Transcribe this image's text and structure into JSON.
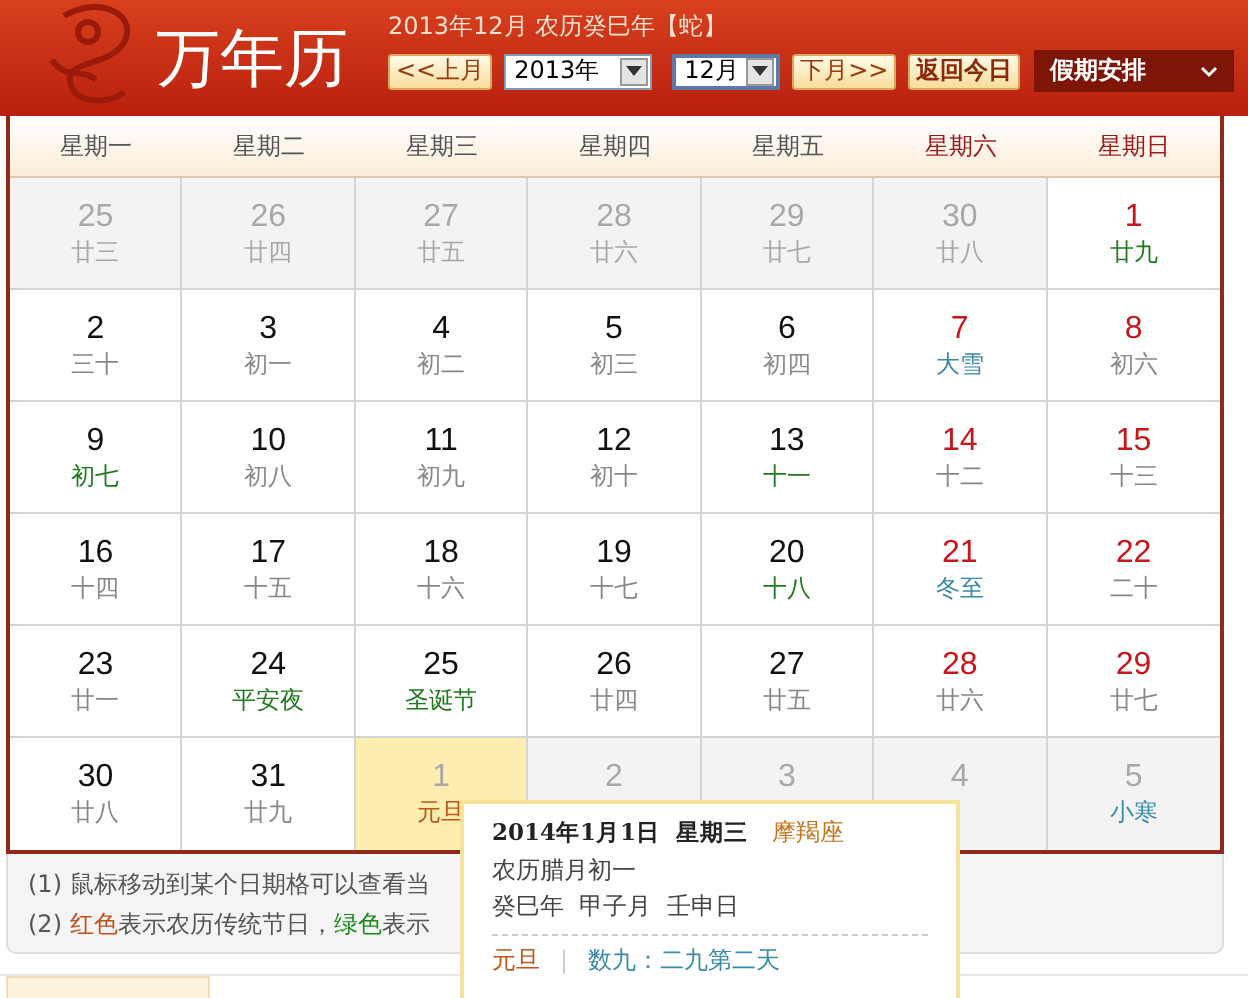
{
  "header": {
    "title": "万年历",
    "subtitle": "2013年12月 农历癸巳年【蛇】",
    "prev_button": "<<上月",
    "year_select": "2013年",
    "month_select": "12月",
    "next_button": "下月>>",
    "today_button": "返回今日",
    "holiday_menu": "假期安排"
  },
  "weekdays": [
    {
      "label": "星期一",
      "weekend": false
    },
    {
      "label": "星期二",
      "weekend": false
    },
    {
      "label": "星期三",
      "weekend": false
    },
    {
      "label": "星期四",
      "weekend": false
    },
    {
      "label": "星期五",
      "weekend": false
    },
    {
      "label": "星期六",
      "weekend": true
    },
    {
      "label": "星期日",
      "weekend": true
    }
  ],
  "weeks": [
    [
      {
        "day": "25",
        "sub": "廿三",
        "in_month": false,
        "color": "#a8a8a8",
        "selected": false
      },
      {
        "day": "26",
        "sub": "廿四",
        "in_month": false,
        "color": "#a8a8a8",
        "selected": false
      },
      {
        "day": "27",
        "sub": "廿五",
        "in_month": false,
        "color": "#a8a8a8",
        "selected": false
      },
      {
        "day": "28",
        "sub": "廿六",
        "in_month": false,
        "color": "#a8a8a8",
        "selected": false
      },
      {
        "day": "29",
        "sub": "廿七",
        "in_month": false,
        "color": "#a8a8a8",
        "selected": false
      },
      {
        "day": "30",
        "sub": "廿八",
        "in_month": false,
        "color": "#a8a8a8",
        "selected": false
      },
      {
        "day": "1",
        "sub": "廿九",
        "in_month": true,
        "weekend": true,
        "color": "#1d7a1d",
        "selected": false
      }
    ],
    [
      {
        "day": "2",
        "sub": "三十",
        "in_month": true,
        "weekend": false,
        "color": "#888888",
        "selected": false
      },
      {
        "day": "3",
        "sub": "初一",
        "in_month": true,
        "weekend": false,
        "color": "#888888",
        "selected": false
      },
      {
        "day": "4",
        "sub": "初二",
        "in_month": true,
        "weekend": false,
        "color": "#888888",
        "selected": false
      },
      {
        "day": "5",
        "sub": "初三",
        "in_month": true,
        "weekend": false,
        "color": "#888888",
        "selected": false
      },
      {
        "day": "6",
        "sub": "初四",
        "in_month": true,
        "weekend": false,
        "color": "#888888",
        "selected": false
      },
      {
        "day": "7",
        "sub": "大雪",
        "in_month": true,
        "weekend": true,
        "color": "#3a8aaa",
        "selected": false
      },
      {
        "day": "8",
        "sub": "初六",
        "in_month": true,
        "weekend": true,
        "color": "#888888",
        "selected": false
      }
    ],
    [
      {
        "day": "9",
        "sub": "初七",
        "in_month": true,
        "weekend": false,
        "color": "#1d7a1d",
        "selected": false
      },
      {
        "day": "10",
        "sub": "初八",
        "in_month": true,
        "weekend": false,
        "color": "#888888",
        "selected": false
      },
      {
        "day": "11",
        "sub": "初九",
        "in_month": true,
        "weekend": false,
        "color": "#888888",
        "selected": false
      },
      {
        "day": "12",
        "sub": "初十",
        "in_month": true,
        "weekend": false,
        "color": "#888888",
        "selected": false
      },
      {
        "day": "13",
        "sub": "十一",
        "in_month": true,
        "weekend": false,
        "color": "#1d7a1d",
        "selected": false
      },
      {
        "day": "14",
        "sub": "十二",
        "in_month": true,
        "weekend": true,
        "color": "#888888",
        "selected": false
      },
      {
        "day": "15",
        "sub": "十三",
        "in_month": true,
        "weekend": true,
        "color": "#888888",
        "selected": false
      }
    ],
    [
      {
        "day": "16",
        "sub": "十四",
        "in_month": true,
        "weekend": false,
        "color": "#888888",
        "selected": false
      },
      {
        "day": "17",
        "sub": "十五",
        "in_month": true,
        "weekend": false,
        "color": "#888888",
        "selected": false
      },
      {
        "day": "18",
        "sub": "十六",
        "in_month": true,
        "weekend": false,
        "color": "#888888",
        "selected": false
      },
      {
        "day": "19",
        "sub": "十七",
        "in_month": true,
        "weekend": false,
        "color": "#888888",
        "selected": false
      },
      {
        "day": "20",
        "sub": "十八",
        "in_month": true,
        "weekend": false,
        "color": "#1d7a1d",
        "selected": false
      },
      {
        "day": "21",
        "sub": "冬至",
        "in_month": true,
        "weekend": true,
        "color": "#3a8aaa",
        "selected": false
      },
      {
        "day": "22",
        "sub": "二十",
        "in_month": true,
        "weekend": true,
        "color": "#888888",
        "selected": false
      }
    ],
    [
      {
        "day": "23",
        "sub": "廿一",
        "in_month": true,
        "weekend": false,
        "color": "#888888",
        "selected": false
      },
      {
        "day": "24",
        "sub": "平安夜",
        "in_month": true,
        "weekend": false,
        "color": "#1d7a1d",
        "selected": false
      },
      {
        "day": "25",
        "sub": "圣诞节",
        "in_month": true,
        "weekend": false,
        "color": "#1d7a1d",
        "selected": false
      },
      {
        "day": "26",
        "sub": "廿四",
        "in_month": true,
        "weekend": false,
        "color": "#888888",
        "selected": false
      },
      {
        "day": "27",
        "sub": "廿五",
        "in_month": true,
        "weekend": false,
        "color": "#888888",
        "selected": false
      },
      {
        "day": "28",
        "sub": "廿六",
        "in_month": true,
        "weekend": true,
        "color": "#888888",
        "selected": false
      },
      {
        "day": "29",
        "sub": "廿七",
        "in_month": true,
        "weekend": true,
        "color": "#888888",
        "selected": false
      }
    ],
    [
      {
        "day": "30",
        "sub": "廿八",
        "in_month": true,
        "weekend": false,
        "color": "#888888",
        "selected": false
      },
      {
        "day": "31",
        "sub": "廿九",
        "in_month": true,
        "weekend": false,
        "color": "#888888",
        "selected": false
      },
      {
        "day": "1",
        "sub": "元旦",
        "in_month": false,
        "color": "#c0561a",
        "selected": true
      },
      {
        "day": "2",
        "in_month": false,
        "selected": false
      },
      {
        "day": "3",
        "in_month": false,
        "selected": false
      },
      {
        "day": "4",
        "in_month": false,
        "selected": false
      },
      {
        "day": "5",
        "sub": "小寒",
        "in_month": false,
        "color": "#3a8aaa",
        "selected": false
      }
    ]
  ],
  "notes": [
    [
      {
        "text": "(1) 鼠标移动到某个日期格可以查看当",
        "kind": "plain"
      }
    ],
    [
      {
        "text": "(2) ",
        "kind": "plain"
      },
      {
        "text": "红色",
        "kind": "red"
      },
      {
        "text": "表示农历传统节日，",
        "kind": "plain"
      },
      {
        "text": "绿色",
        "kind": "green"
      },
      {
        "text": "表示",
        "kind": "plain"
      }
    ]
  ],
  "tooltip": {
    "date": "2014年1月1日  星期三",
    "sign": "摩羯座",
    "lunar": "农历腊月初一",
    "ganzhi": "癸巳年  甲子月  壬申日",
    "festival": "元旦",
    "separator": "|",
    "shujiu": "数九：二九第二天"
  }
}
